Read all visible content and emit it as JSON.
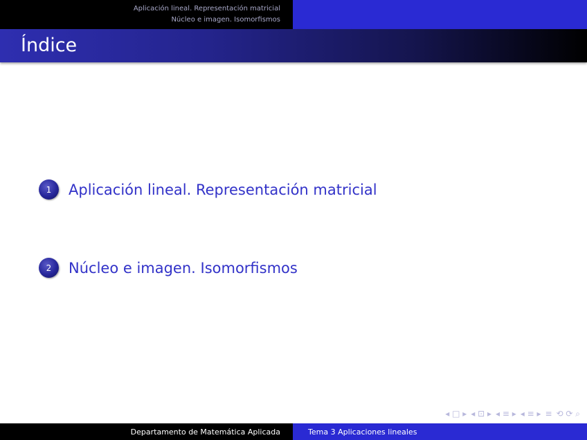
{
  "header": {
    "section_1": "Aplicación lineal. Representación matricial",
    "section_2": "Núcleo e imagen. Isomorfismos"
  },
  "frame": {
    "title": "Índice"
  },
  "toc": {
    "items": [
      {
        "number": "1",
        "label": "Aplicación lineal. Representación matricial"
      },
      {
        "number": "2",
        "label": "Núcleo e imagen. Isomorfismos"
      }
    ]
  },
  "footer": {
    "institution": "Departamento de Matemática Aplicada",
    "short_title": "Tema 3 Aplicaciones lineales"
  },
  "navigation": {
    "first_frame": "◂ □ ▸",
    "section": "◂ ⊡ ▸",
    "subsection_back": "◂ ≡ ▸",
    "subsection_fwd": "◂ ≡ ▸",
    "equiv": "≡",
    "search": "⟲ ⟳ ⌕"
  },
  "colors": {
    "accent": "#2a2ad3",
    "text_link": "#3232c8",
    "bar_dark": "#000000"
  }
}
